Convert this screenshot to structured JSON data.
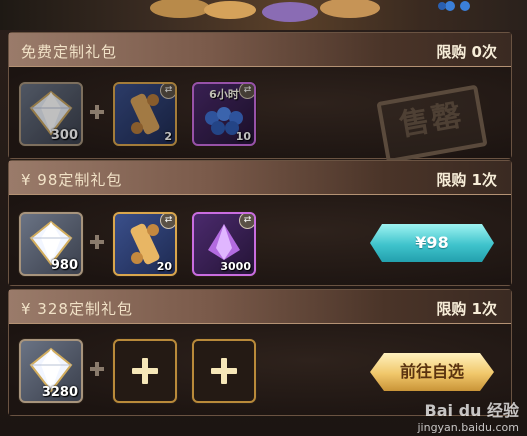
{
  "panels": [
    {
      "title": "免费定制礼包",
      "limit": "限购 0次",
      "items": [
        {
          "icon": "diamond-icon",
          "qty": "300"
        },
        {
          "icon": "scroll-icon",
          "qty": "2"
        },
        {
          "icon": "blue-orbs-icon",
          "qty": "10",
          "label": "6小时"
        }
      ],
      "stamp": "售罄"
    },
    {
      "title": "¥ 98定制礼包",
      "limit": "限购 1次",
      "items": [
        {
          "icon": "diamond-icon",
          "qty": "980"
        },
        {
          "icon": "scroll-icon",
          "qty": "20"
        },
        {
          "icon": "purple-crystal-icon",
          "qty": "3000"
        }
      ],
      "button": "¥98"
    },
    {
      "title": "¥ 328定制礼包",
      "limit": "限购 1次",
      "items": [
        {
          "icon": "diamond-icon",
          "qty": "3280"
        }
      ],
      "button": "前往自选"
    }
  ],
  "watermark": {
    "brand": "Bai du 经验",
    "url": "jingyan.baidu.com"
  }
}
